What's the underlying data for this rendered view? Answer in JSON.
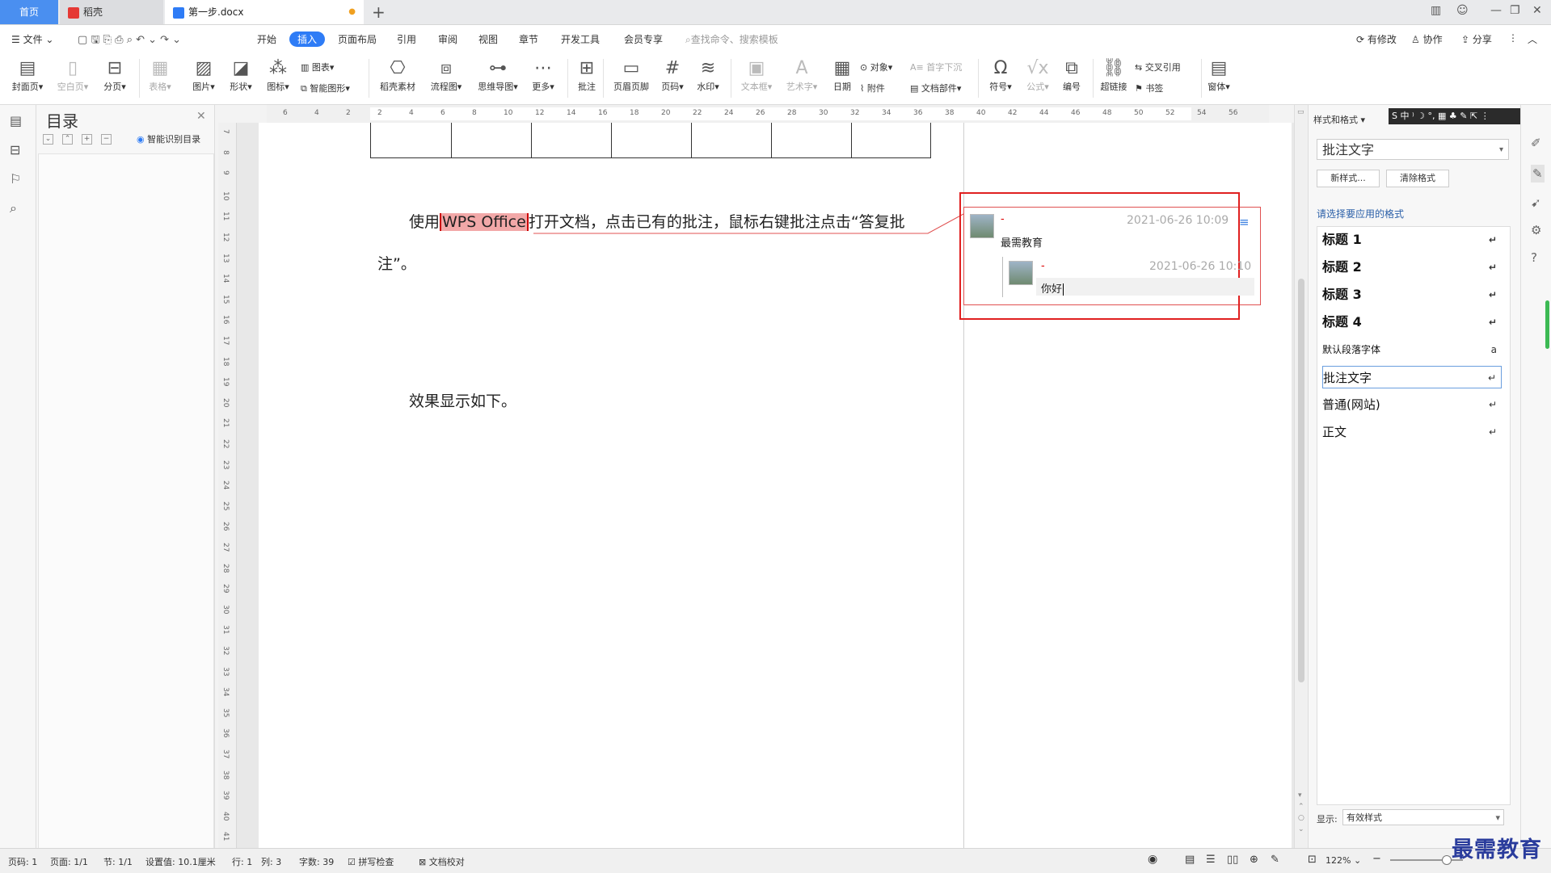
{
  "tabs": {
    "home": "首页",
    "daoke": "稻壳",
    "doc": "第一步.docx"
  },
  "menu": {
    "file": "文件",
    "start": "开始",
    "insert": "插入",
    "layout": "页面布局",
    "reference": "引用",
    "review": "审阅",
    "view": "视图",
    "chapter": "章节",
    "devtools": "开发工具",
    "member": "会员专享",
    "search": "查找命令、搜索模板",
    "modified": "有修改",
    "collab": "协作",
    "share": "分享"
  },
  "ribbon": {
    "cover": "封面页",
    "blank": "空白页",
    "pagebreak": "分页",
    "table": "表格",
    "picture": "图片",
    "shape": "形状",
    "icon": "图标",
    "chart": "图表",
    "smartshape": "智能图形",
    "daoke_material": "稻壳素材",
    "flowchart": "流程图",
    "mindmap": "思维导图",
    "more": "更多",
    "comment": "批注",
    "headerfooter": "页眉页脚",
    "pagenum": "页码",
    "watermark": "水印",
    "textbox": "文本框",
    "arttext": "艺术字",
    "date": "日期",
    "object": "对象",
    "attachment": "附件",
    "dropcap": "首字下沉",
    "docpart": "文档部件",
    "symbol": "符号",
    "formula": "公式",
    "numbering": "编号",
    "hyperlink": "超链接",
    "crossref": "交叉引用",
    "bookmark": "书签",
    "window": "窗体"
  },
  "toc": {
    "title": "目录",
    "smart": "智能识别目录"
  },
  "ruler_h": [
    "6",
    "4",
    "2",
    "2",
    "4",
    "6",
    "8",
    "10",
    "12",
    "14",
    "16",
    "18",
    "20",
    "22",
    "24",
    "26",
    "28",
    "30",
    "32",
    "34",
    "36",
    "38",
    "40",
    "42",
    "44",
    "46",
    "48",
    "50",
    "52",
    "54",
    "56"
  ],
  "ruler_v": [
    "7",
    "8",
    "9",
    "10",
    "11",
    "12",
    "13",
    "14",
    "15",
    "16",
    "17",
    "18",
    "19",
    "20",
    "21",
    "22",
    "23",
    "24",
    "25",
    "26",
    "27",
    "28",
    "29",
    "30",
    "31",
    "32",
    "33",
    "34",
    "35",
    "36",
    "37",
    "38",
    "39",
    "40",
    "41"
  ],
  "doc": {
    "para1_a": "使用",
    "para1_hl": "WPS Office",
    "para1_b": "打开文档，点击已有的批注，鼠标右键批注点击“答复批",
    "para1_c": "注”。",
    "para2": "效果显示如下。"
  },
  "comment": {
    "author": "-",
    "date": "2021-06-26 10:09",
    "text": "最需教育",
    "reply_author": "-",
    "reply_date": "2021-06-26 10:10",
    "reply_text": "你好"
  },
  "stylepanel": {
    "header": "样式和格式",
    "current": "批注文字",
    "new_style": "新样式...",
    "clear_format": "清除格式",
    "apply_label": "请选择要应用的格式",
    "styles": [
      "标题 1",
      "标题 2",
      "标题 3",
      "标题 4",
      "默认段落字体",
      "批注文字",
      "普通(网站)",
      "正文"
    ],
    "show_label": "显示:",
    "show_value": "有效样式"
  },
  "ime": "S 中 ⁾ ☽ °, ▦ ♣ ✎ ⇱ ⋮",
  "status": {
    "pagenum": "页码: 1",
    "pages": "页面: 1/1",
    "section": "节: 1/1",
    "setting": "设置值: 10.1厘米",
    "row": "行: 1",
    "col": "列: 3",
    "words": "字数: 39",
    "spell": "拼写检查",
    "proof": "文档校对",
    "zoom": "122%"
  },
  "watermark": "最需教育",
  "colors": {
    "accent": "#2e7cf6",
    "comment_border": "#e02020",
    "highlight": "#f2a8a8"
  }
}
